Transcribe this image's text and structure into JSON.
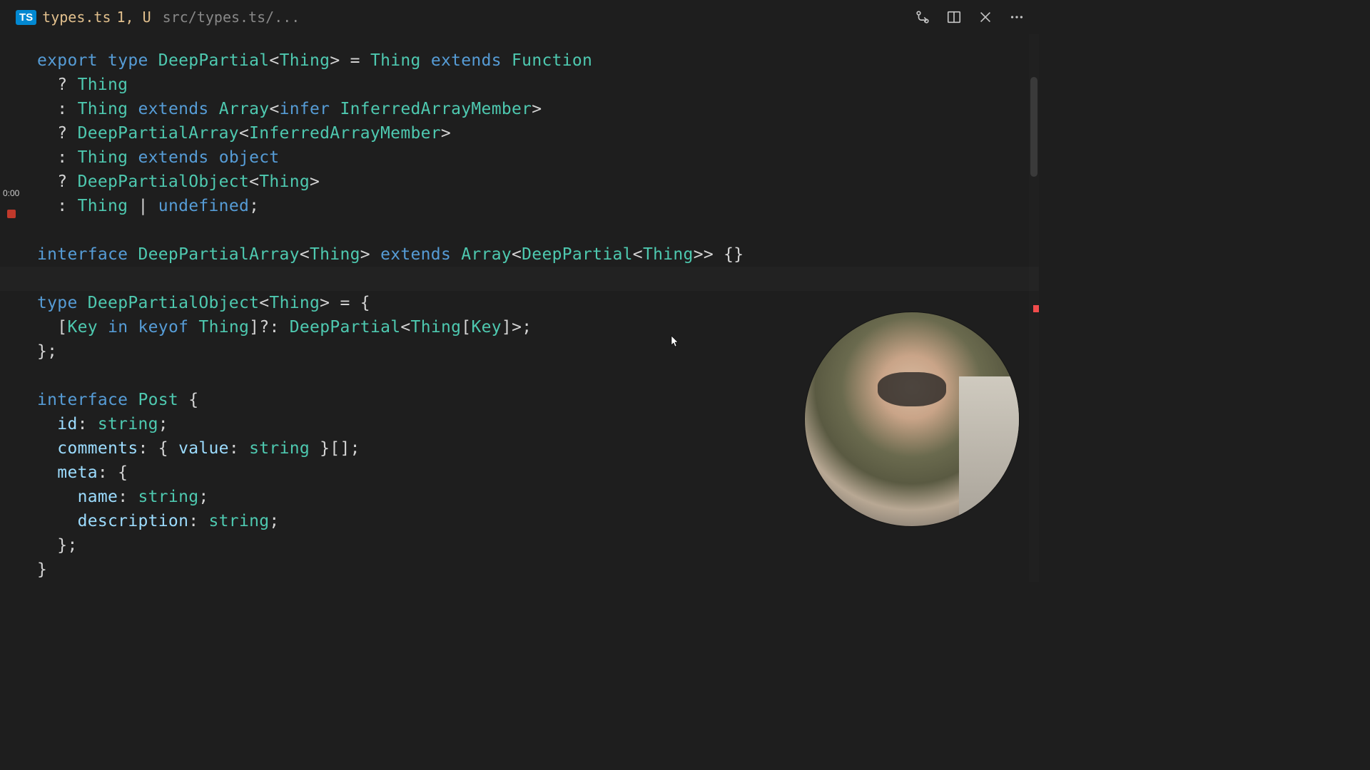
{
  "tab": {
    "lang_badge": "TS",
    "filename": "types.ts",
    "status": "1, U",
    "breadcrumb": "src/types.ts/..."
  },
  "overlay": {
    "timestamp": "0:00"
  },
  "code": {
    "l1": {
      "kw1": "export",
      "kw2": "type",
      "name": "DeepPartial",
      "lt": "<",
      "p1": "Thing",
      "gt": ">",
      "eq": " = ",
      "p2": "Thing",
      "ext": "extends",
      "fn": "Function"
    },
    "l2": {
      "q": "  ? ",
      "t": "Thing"
    },
    "l3": {
      "c": "  : ",
      "t": "Thing",
      "ext": "extends",
      "arr": "Array",
      "lt": "<",
      "inf": "infer",
      "mem": "InferredArrayMember",
      "gt": ">"
    },
    "l4": {
      "q": "  ? ",
      "dpa": "DeepPartialArray",
      "lt": "<",
      "mem": "InferredArrayMember",
      "gt": ">"
    },
    "l5": {
      "c": "  : ",
      "t": "Thing",
      "ext": "extends",
      "obj": "object"
    },
    "l6": {
      "q": "  ? ",
      "dpo": "DeepPartialObject",
      "lt": "<",
      "t": "Thing",
      "gt": ">"
    },
    "l7": {
      "c": "  : ",
      "t": "Thing",
      "pipe": " | ",
      "und": "undefined",
      "semi": ";"
    },
    "l9": {
      "iface": "interface",
      "name": "DeepPartialArray",
      "lt": "<",
      "p": "Thing",
      "gt": ">",
      "ext": "extends",
      "arr": "Array",
      "lt2": "<",
      "dp": "DeepPartial",
      "lt3": "<",
      "p2": "Thing",
      "gt3": ">>",
      "br": " {}"
    },
    "l11": {
      "kw": "type",
      "name": "DeepPartialObject",
      "lt": "<",
      "p": "Thing",
      "gt": ">",
      "eq": " = {"
    },
    "l12": {
      "open": "  [",
      "key": "Key",
      "in": "in",
      "keyof": "keyof",
      "t": "Thing",
      "close": "]?: ",
      "dp": "DeepPartial",
      "lt": "<",
      "t2": "Thing",
      "br": "[",
      "k2": "Key",
      "br2": "]",
      "gt": ">;"
    },
    "l13": {
      "txt": "};"
    },
    "l15": {
      "iface": "interface",
      "name": "Post",
      "br": " {"
    },
    "l16": {
      "prop": "id",
      "col": ": ",
      "type": "string",
      "semi": ";"
    },
    "l17": {
      "prop": "comments",
      "col": ": { ",
      "vprop": "value",
      "col2": ": ",
      "type": "string",
      "end": " }[];"
    },
    "l18": {
      "prop": "meta",
      "col": ": {"
    },
    "l19": {
      "prop": "name",
      "col": ": ",
      "type": "string",
      "semi": ";"
    },
    "l20": {
      "prop": "description",
      "col": ": ",
      "type": "string",
      "semi": ";"
    },
    "l21": {
      "txt": "  };"
    },
    "l22": {
      "txt": "}"
    }
  }
}
